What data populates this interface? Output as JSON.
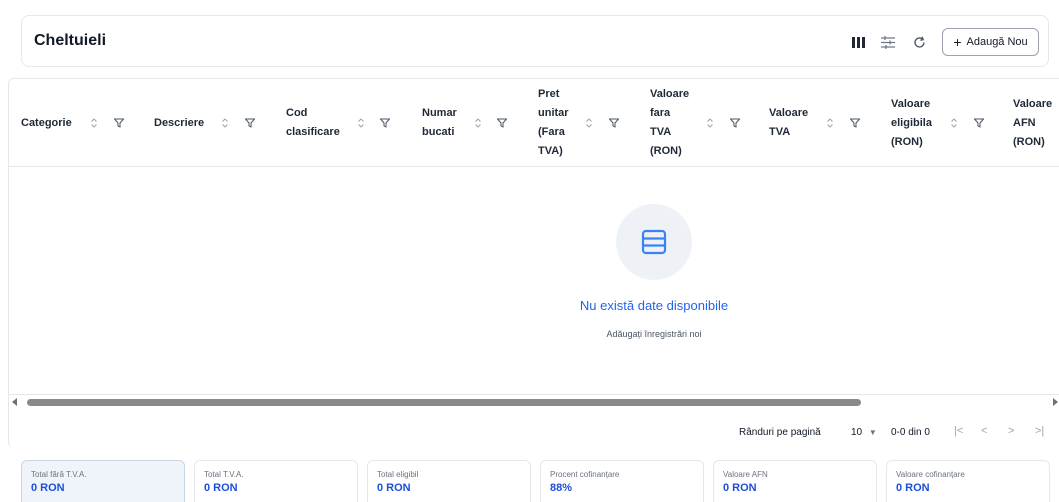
{
  "header": {
    "title": "Cheltuieli",
    "add_button": "+ Adaugă Nou",
    "add_button_label": "Adaugă Nou",
    "icons": [
      "columns-icon",
      "density-icon",
      "refresh-icon"
    ]
  },
  "table": {
    "columns": [
      {
        "lines": [
          "Categorie"
        ]
      },
      {
        "lines": [
          "Descriere"
        ]
      },
      {
        "lines": [
          "Cod",
          "clasificare"
        ]
      },
      {
        "lines": [
          "Numar",
          "bucati"
        ]
      },
      {
        "lines": [
          "Pret",
          "unitar",
          "(Fara",
          "TVA)"
        ]
      },
      {
        "lines": [
          "Valoare",
          "fara",
          "TVA",
          "(RON)"
        ]
      },
      {
        "lines": [
          "Valoare",
          "TVA"
        ]
      },
      {
        "lines": [
          "Valoare",
          "eligibila",
          "(RON)"
        ]
      },
      {
        "lines": [
          "Valoare",
          "AFN",
          "(RON)"
        ]
      }
    ],
    "empty_title": "Nu există date disponibile",
    "empty_subtitle": "Adăugați înregistrări noi"
  },
  "pagination": {
    "rows_per_page_label": "Rânduri pe pagină",
    "rows_per_page_value": "10",
    "range": "0-0 din 0"
  },
  "summary": [
    {
      "label": "Total fără T.V.A.",
      "value": "0 RON"
    },
    {
      "label": "Total T.V.A.",
      "value": "0 RON"
    },
    {
      "label": "Total eligibil",
      "value": "0 RON"
    },
    {
      "label": "Procent cofinanțare",
      "value": "88%"
    },
    {
      "label": "Valoare AFN",
      "value": "0 RON"
    },
    {
      "label": "Valoare cofinanțare",
      "value": "0 RON"
    }
  ],
  "colors": {
    "accent": "#2563eb",
    "summary_value": "#1d4ed8",
    "active_card_bg": "#eff4fb"
  }
}
